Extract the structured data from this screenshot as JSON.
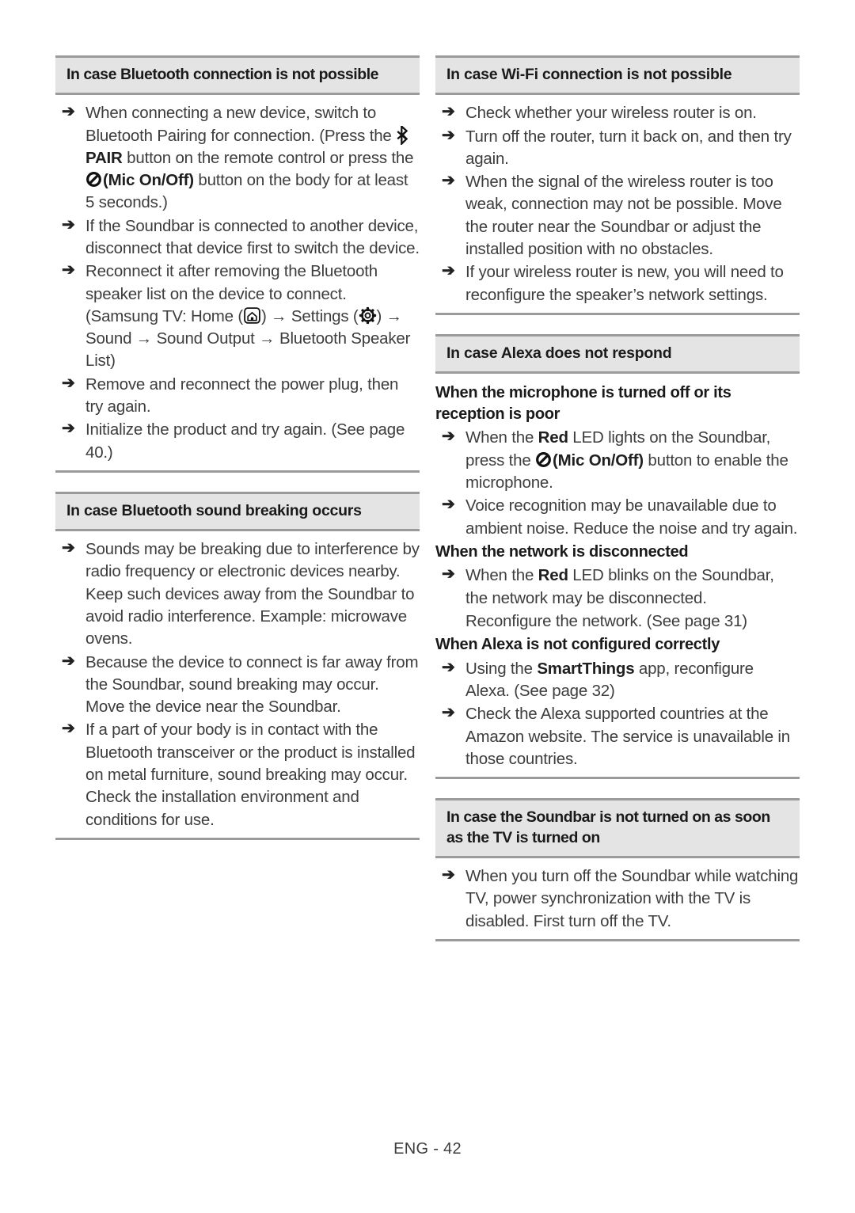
{
  "page": {
    "footer_label": "ENG - 42"
  },
  "left_column": {
    "sections": [
      {
        "id": "bluetooth-connection",
        "heading": "In case Bluetooth connection is not possible",
        "bullets": [
          {
            "parts": [
              {
                "t": "text",
                "v": "When connecting a new device, switch to Bluetooth Pairing for connection. (Press the "
              },
              {
                "t": "icon",
                "v": "bluetooth-icon"
              },
              {
                "t": "bold",
                "v": "PAIR"
              },
              {
                "t": "text",
                "v": " button on the remote control or press the "
              },
              {
                "t": "icon",
                "v": "mic-on-off-icon"
              },
              {
                "t": "bold",
                "v": "(Mic On/Off)"
              },
              {
                "t": "text",
                "v": " button on the body for at least 5 seconds.)"
              }
            ]
          },
          {
            "parts": [
              {
                "t": "text",
                "v": "If the Soundbar is connected to another device, disconnect that device first to switch the device."
              }
            ]
          },
          {
            "parts": [
              {
                "t": "text",
                "v": "Reconnect it after removing the Bluetooth speaker list on the device to connect. (Samsung TV: Home ("
              },
              {
                "t": "icon",
                "v": "home-icon"
              },
              {
                "t": "text",
                "v": ") → Settings ("
              },
              {
                "t": "icon",
                "v": "gear-icon"
              },
              {
                "t": "text",
                "v": ") → Sound → Sound Output → Bluetooth Speaker List)"
              }
            ]
          },
          {
            "parts": [
              {
                "t": "text",
                "v": "Remove and reconnect the power plug, then try again."
              }
            ]
          },
          {
            "parts": [
              {
                "t": "text",
                "v": "Initialize the product and try again. (See page 40.)"
              }
            ]
          }
        ]
      },
      {
        "id": "bluetooth-sound-breaking",
        "heading": "In case Bluetooth sound breaking occurs",
        "bullets": [
          {
            "parts": [
              {
                "t": "text",
                "v": "Sounds may be breaking due to interference by radio frequency or electronic devices nearby. Keep such devices away from the Soundbar to avoid radio interference. Example: microwave ovens."
              }
            ]
          },
          {
            "parts": [
              {
                "t": "text",
                "v": "Because the device to connect is far away from the Soundbar, sound breaking may occur. Move the device near the Soundbar."
              }
            ]
          },
          {
            "parts": [
              {
                "t": "text",
                "v": "If a part of your body is in contact with the Bluetooth transceiver or the product is installed on metal furniture, sound breaking may occur. Check the installation environment and conditions for use."
              }
            ]
          }
        ]
      }
    ]
  },
  "right_column": {
    "sections": [
      {
        "id": "wifi-connection",
        "heading": "In case Wi-Fi connection is not possible",
        "bullets": [
          {
            "parts": [
              {
                "t": "text",
                "v": "Check whether your wireless router is on."
              }
            ]
          },
          {
            "parts": [
              {
                "t": "text",
                "v": "Turn off the router, turn it back on, and then try again."
              }
            ]
          },
          {
            "parts": [
              {
                "t": "text",
                "v": "When the signal of the wireless router is too weak, connection may not be possible. Move the router near the Soundbar or adjust the installed position with no obstacles."
              }
            ]
          },
          {
            "parts": [
              {
                "t": "text",
                "v": "If your wireless router is new, you will need to reconfigure the speaker’s network settings."
              }
            ]
          }
        ]
      },
      {
        "id": "alexa-no-respond",
        "heading": "In case Alexa does not respond",
        "groups": [
          {
            "sub_heading": "When the microphone is turned off or its reception is poor",
            "bullets": [
              {
                "parts": [
                  {
                    "t": "text",
                    "v": "When the "
                  },
                  {
                    "t": "bold",
                    "v": "Red"
                  },
                  {
                    "t": "text",
                    "v": " LED lights on the Soundbar, press the "
                  },
                  {
                    "t": "icon",
                    "v": "mic-on-off-icon"
                  },
                  {
                    "t": "bold",
                    "v": "(Mic On/Off)"
                  },
                  {
                    "t": "text",
                    "v": " button to enable the microphone."
                  }
                ]
              },
              {
                "parts": [
                  {
                    "t": "text",
                    "v": "Voice recognition may be unavailable due to ambient noise. Reduce the noise and try again."
                  }
                ]
              }
            ]
          },
          {
            "sub_heading": "When the network is disconnected",
            "bullets": [
              {
                "parts": [
                  {
                    "t": "text",
                    "v": "When the "
                  },
                  {
                    "t": "bold",
                    "v": "Red"
                  },
                  {
                    "t": "text",
                    "v": " LED blinks on the Soundbar, the network may be disconnected."
                  }
                ],
                "continuation": "Reconfigure the network. (See page 31)"
              }
            ]
          },
          {
            "sub_heading": "When Alexa is not configured correctly",
            "bullets": [
              {
                "parts": [
                  {
                    "t": "text",
                    "v": "Using the "
                  },
                  {
                    "t": "bold",
                    "v": "SmartThings"
                  },
                  {
                    "t": "text",
                    "v": " app, reconfigure Alexa. (See page 32)"
                  }
                ]
              },
              {
                "parts": [
                  {
                    "t": "text",
                    "v": "Check the Alexa supported countries at the Amazon website. The service is unavailable in those countries."
                  }
                ]
              }
            ]
          }
        ]
      },
      {
        "id": "soundbar-not-turned-on",
        "heading": "In case the Soundbar is not turned on as soon as the TV is turned on",
        "bullets": [
          {
            "parts": [
              {
                "t": "text",
                "v": "When you turn off the Soundbar while watching TV, power synchronization with the TV is disabled. First turn off the TV."
              }
            ]
          }
        ]
      }
    ]
  },
  "glyphs": {
    "bullet_arrow": "➔"
  },
  "colors": {
    "header_band": "#e4e4e4",
    "header_rule": "#9b9b9b",
    "body_text": "#3d3d3d",
    "heading_text": "#1a1a1a"
  }
}
